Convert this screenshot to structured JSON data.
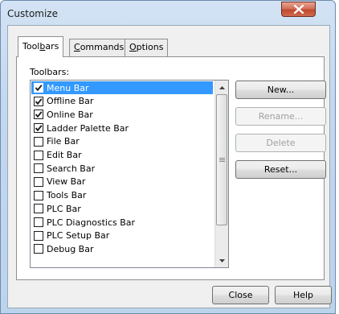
{
  "window": {
    "title": "Customize"
  },
  "tabs": [
    {
      "label_pre": "Tool",
      "label_u": "b",
      "label_post": "ars",
      "active": true
    },
    {
      "label_pre": "",
      "label_u": "C",
      "label_post": "ommands",
      "active": false
    },
    {
      "label_pre": "",
      "label_u": "O",
      "label_post": "ptions",
      "active": false
    }
  ],
  "toolbars_label": "Toolbars:",
  "toolbars": [
    {
      "label": "Menu Bar",
      "checked": true,
      "selected": true
    },
    {
      "label": "Offline Bar",
      "checked": true,
      "selected": false
    },
    {
      "label": "Online Bar",
      "checked": true,
      "selected": false
    },
    {
      "label": "Ladder Palette Bar",
      "checked": true,
      "selected": false
    },
    {
      "label": "File Bar",
      "checked": false,
      "selected": false
    },
    {
      "label": "Edit Bar",
      "checked": false,
      "selected": false
    },
    {
      "label": "Search Bar",
      "checked": false,
      "selected": false
    },
    {
      "label": "View Bar",
      "checked": false,
      "selected": false
    },
    {
      "label": "Tools Bar",
      "checked": false,
      "selected": false
    },
    {
      "label": "PLC Bar",
      "checked": false,
      "selected": false
    },
    {
      "label": "PLC Diagnostics Bar",
      "checked": false,
      "selected": false
    },
    {
      "label": "PLC Setup Bar",
      "checked": false,
      "selected": false
    },
    {
      "label": "Debug Bar",
      "checked": false,
      "selected": false
    }
  ],
  "buttons": {
    "new": "New...",
    "rename": "Rename...",
    "delete": "Delete",
    "reset": "Reset...",
    "close": "Close",
    "help": "Help"
  },
  "colors": {
    "selection": "#3399ff",
    "close_button": "#c04a2f"
  }
}
